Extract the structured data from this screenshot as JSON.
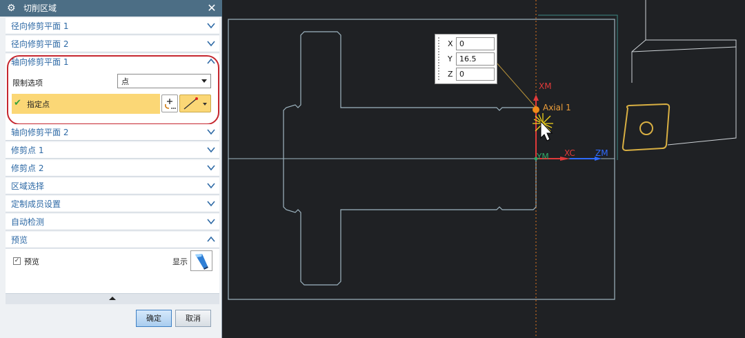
{
  "dialog": {
    "title": "切削区域",
    "sections": {
      "radial_plane_1": "径向修剪平面 1",
      "radial_plane_2": "径向修剪平面 2",
      "axial_plane_1": "轴向修剪平面 1",
      "axial_plane_2": "轴向修剪平面 2",
      "trim_point_1": "修剪点 1",
      "trim_point_2": "修剪点 2",
      "region_select": "区域选择",
      "custom_member": "定制成员设置",
      "auto_detect": "自动检测",
      "preview": "预览"
    },
    "axial_plane_1": {
      "limit_option_label": "限制选项",
      "limit_option_value": "点",
      "specify_point_label": "指定点"
    },
    "preview": {
      "checkbox_label": "预览",
      "checkbox_checked": true,
      "show_label": "显示"
    },
    "buttons": {
      "ok": "确定",
      "cancel": "取消"
    }
  },
  "coordinates": {
    "x_label": "X",
    "x_value": "0",
    "y_label": "Y",
    "y_value": "16.5",
    "z_label": "Z",
    "z_value": "0"
  },
  "viewport_labels": {
    "xm": "XM",
    "axial": "Axial 1",
    "ym": "YM",
    "xc": "XC",
    "zm": "ZM"
  },
  "colors": {
    "title_bar": "#4c6e85",
    "section_text": "#2d69a5",
    "highlight": "#fbd776",
    "annotation_loop": "#c5262e",
    "canvas_bg": "#1f2124",
    "geometry": "#9fb6c2",
    "axis_red": "#e03a3a",
    "axis_blue": "#2f6bff",
    "axis_green": "#2fa866",
    "point_orange": "#f08a18"
  }
}
